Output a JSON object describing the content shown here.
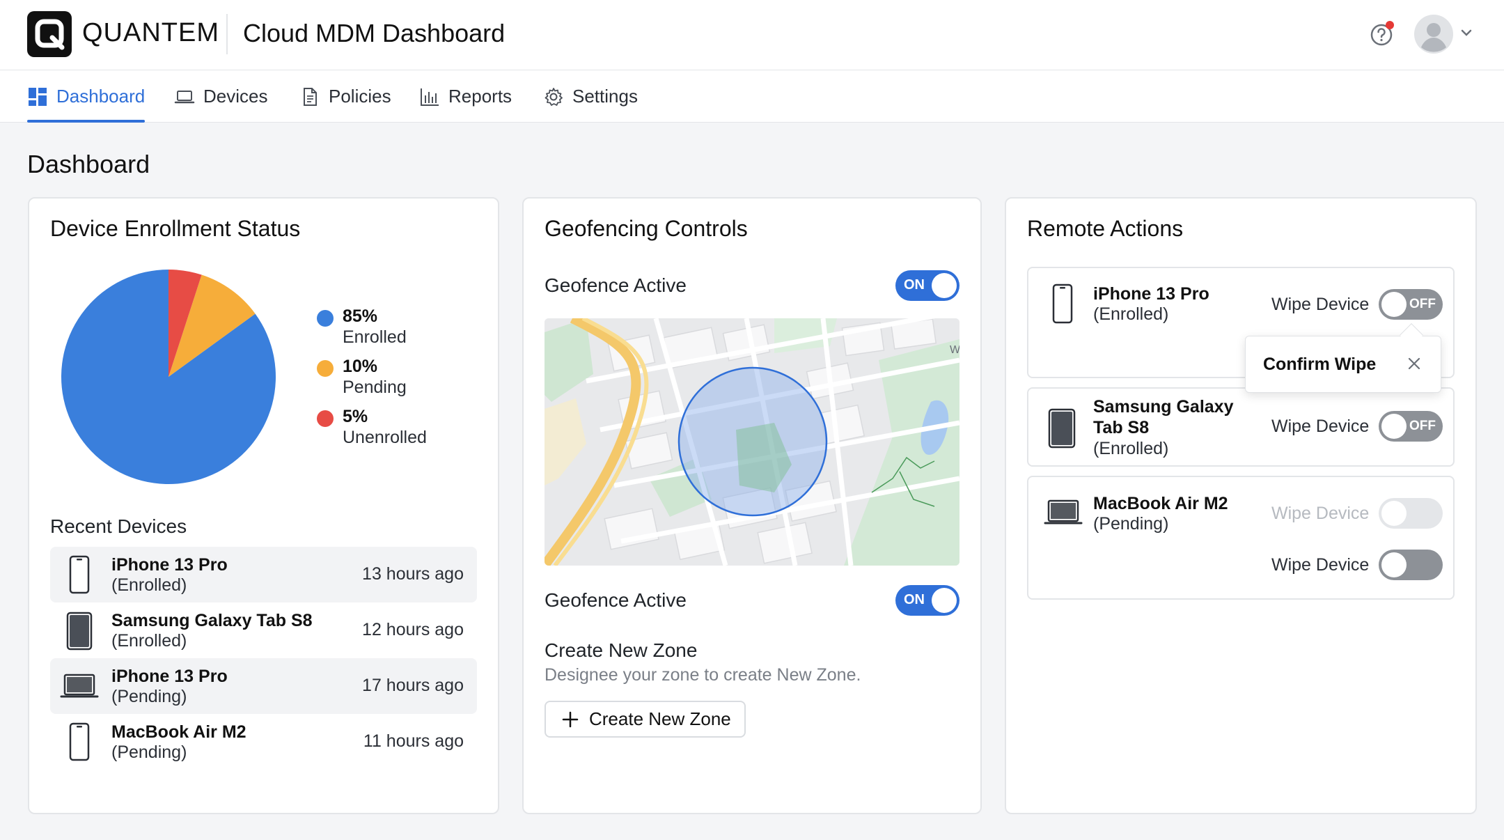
{
  "header": {
    "logo_letter": "Q",
    "brand": "QUANTEM",
    "app_title": "Cloud MDM Dashboard"
  },
  "nav": {
    "tabs": [
      {
        "label": "Dashboard",
        "icon": "dashboard-icon",
        "active": true
      },
      {
        "label": "Devices",
        "icon": "laptop-icon",
        "active": false
      },
      {
        "label": "Policies",
        "icon": "document-icon",
        "active": false
      },
      {
        "label": "Reports",
        "icon": "bar-chart-icon",
        "active": false
      },
      {
        "label": "Settings",
        "icon": "gear-icon",
        "active": false
      }
    ]
  },
  "page": {
    "title": "Dashboard"
  },
  "enrollment": {
    "title": "Device Enrollment Status",
    "chart_data": {
      "type": "pie",
      "slices": [
        {
          "pct": "85%",
          "value": 85,
          "label": "Enrolled",
          "color": "#3a7fdc"
        },
        {
          "pct": "10%",
          "value": 10,
          "label": "Pending",
          "color": "#f6ad3a"
        },
        {
          "pct": "5%",
          "value": 5,
          "label": "Unenrolled",
          "color": "#e74c45"
        }
      ]
    },
    "recent_title": "Recent Devices",
    "recent": [
      {
        "name": "iPhone 13 Pro",
        "status": "(Enrolled)",
        "time": "13 hours ago",
        "icon": "phone-icon"
      },
      {
        "name": "Samsung Galaxy Tab S8",
        "status": "(Enrolled)",
        "time": "12 hours ago",
        "icon": "tablet-icon"
      },
      {
        "name": "iPhone 13 Pro",
        "status": "(Pending)",
        "time": "17 hours ago",
        "icon": "laptop-icon"
      },
      {
        "name": "MacBook Air M2",
        "status": "(Pending)",
        "time": "11 hours ago",
        "icon": "phone-icon"
      }
    ]
  },
  "geofence": {
    "title": "Geofencing Controls",
    "toggle1_label": "Geofence Active",
    "toggle1_state": "ON",
    "toggle2_label": "Geofence Active",
    "toggle2_state": "ON",
    "map_edge_letter": "W",
    "zone_title": "Create New Zone",
    "zone_subtitle": "Designee your zone to create New Zone.",
    "zone_button": "Create New Zone"
  },
  "remote": {
    "title": "Remote Actions",
    "devices": [
      {
        "name": "iPhone 13 Pro",
        "status": "(Enrolled)",
        "wipe_label": "Wipe Device",
        "toggle": "OFF"
      },
      {
        "name": "Samsung Galaxy",
        "name2": "Tab S8",
        "status": "(Enrolled)",
        "wipe_label": "Wipe Device",
        "toggle": "OFF"
      },
      {
        "name": "MacBook Air M2",
        "status": "(Pending)",
        "wipe_label": "Wipe Device",
        "wipe_label2": "Wipe Device"
      }
    ],
    "popover": {
      "text": "Confirm Wipe"
    }
  }
}
